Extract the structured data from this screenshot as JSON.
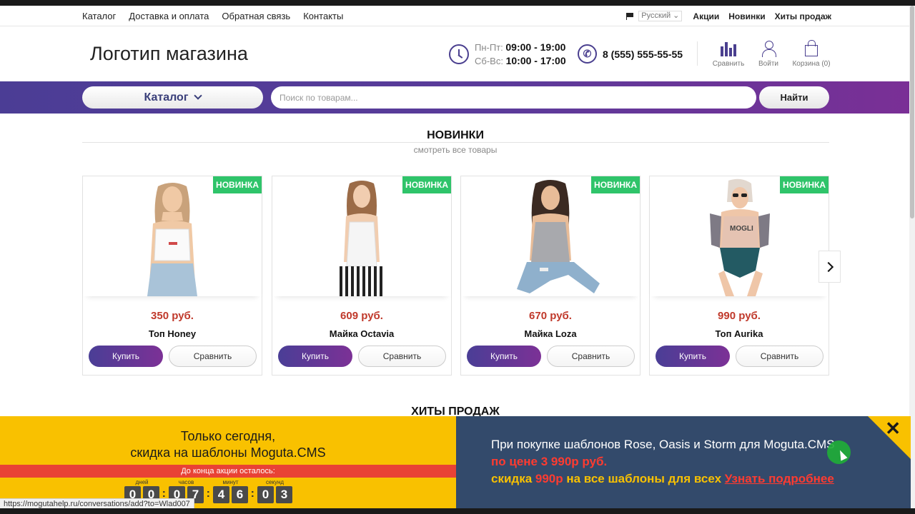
{
  "topnav": {
    "links": [
      "Каталог",
      "Доставка и оплата",
      "Обратная связь",
      "Контакты"
    ],
    "language": "Русский",
    "right_links": [
      "Акции",
      "Новинки",
      "Хиты продаж"
    ]
  },
  "header": {
    "logo": "Логотип магазина",
    "hours": {
      "weekdays_label": "Пн-Пт:",
      "weekdays_time": "09:00 - 19:00",
      "weekend_label": "Сб-Вс:",
      "weekend_time": "10:00 - 17:00"
    },
    "phone": "8 (555) 555-55-55",
    "icons": {
      "compare": "Сравнить",
      "login": "Войти",
      "cart": "Корзина (0)"
    }
  },
  "searchbar": {
    "catalog_label": "Каталог",
    "placeholder": "Поиск по товарам...",
    "button": "Найти"
  },
  "new_section": {
    "title": "НОВИНКИ",
    "subtitle": "смотреть все товары",
    "products": [
      {
        "badge": "НОВИНКА",
        "price": "350 руб.",
        "name": "Топ Honey",
        "buy": "Купить",
        "compare": "Сравнить"
      },
      {
        "badge": "НОВИНКА",
        "price": "609 руб.",
        "name": "Майка Octavia",
        "buy": "Купить",
        "compare": "Сравнить"
      },
      {
        "badge": "НОВИНКА",
        "price": "670 руб.",
        "name": "Майка Loza",
        "buy": "Купить",
        "compare": "Сравнить"
      },
      {
        "badge": "НОВИНКА",
        "price": "990 руб.",
        "name": "Топ Aurika",
        "buy": "Купить",
        "compare": "Сравнить"
      }
    ]
  },
  "hits_section": {
    "title": "ХИТЫ ПРОДАЖ"
  },
  "promo": {
    "left_line1": "Только сегодня,",
    "left_line2": "скидка на шаблоны Moguta.CMS",
    "countdown_label": "До конца акции осталось:",
    "timer": [
      {
        "label": "дней",
        "digits": [
          "0",
          "0"
        ]
      },
      {
        "label": "часов",
        "digits": [
          "0",
          "7"
        ]
      },
      {
        "label": "минут",
        "digits": [
          "4",
          "6"
        ]
      },
      {
        "label": "секунд",
        "digits": [
          "0",
          "3"
        ]
      }
    ],
    "right_line1": "При покупке шаблонов Rose, Oasis и Storm для Moguta.CMS",
    "right_line2": "по цене 3 990р руб.",
    "right_line3_a": "скидка ",
    "right_line3_b": "990р",
    "right_line3_c": " на все шаблоны для всех ",
    "right_link": "Узнать подробнее",
    "close": "✕"
  },
  "statusbar": "https://mogutahelp.ru/conversations/add?to=Wlad007",
  "colors": {
    "accent": "#4b3d95",
    "badge": "#2fc46a",
    "price": "#c0392b",
    "promo_yellow": "#f9c100",
    "promo_blue": "#334a6b",
    "promo_red": "#e94235"
  }
}
